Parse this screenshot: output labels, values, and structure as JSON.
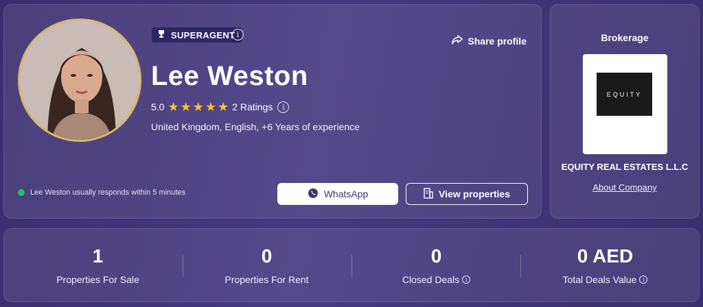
{
  "profile": {
    "badge": "SUPERAGENT",
    "share_label": "Share profile",
    "name": "Lee Weston",
    "rating_value": "5.0",
    "star_count": 5,
    "ratings_label": "2 Ratings",
    "meta": "United Kingdom, English, +6 Years of experience",
    "response_text": "Lee Weston usually responds within 5 minutes",
    "whatsapp_label": "WhatsApp",
    "view_properties_label": "View properties"
  },
  "brokerage": {
    "title": "Brokerage",
    "logo_text": "EQUITY",
    "name": "EQUITY REAL ESTATES L.L.C",
    "about_label": "About Company"
  },
  "stats": [
    {
      "value": "1",
      "label": "Properties For Sale",
      "info": false
    },
    {
      "value": "0",
      "label": "Properties For Rent",
      "info": false
    },
    {
      "value": "0",
      "label": "Closed Deals",
      "info": true
    },
    {
      "value": "0 AED",
      "label": "Total Deals Value",
      "info": true
    }
  ],
  "colors": {
    "accent_star": "#f7c233",
    "online_dot": "#24c067",
    "avatar_ring": "#d8b86e",
    "button_text": "#3d3470"
  }
}
